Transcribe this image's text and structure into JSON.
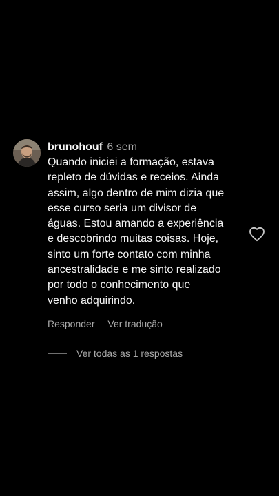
{
  "comment": {
    "username": "brunohouf",
    "timestamp": "6 sem",
    "text_lines": [
      "Quando iniciei a formação, estava",
      "repleto de dúvidas e receios. Ainda",
      "assim, algo dentro de mim dizia que",
      "esse curso seria um divisor de",
      "águas. Estou amando a experiência",
      "e descobrindo muitas coisas. Hoje,",
      "sinto um forte contato com minha",
      "ancestralidade e me sinto realizado",
      "por todo o conhecimento que",
      "venho adquirindo."
    ],
    "avatar_icon": "user-avatar",
    "like_icon": "heart-outline-icon"
  },
  "actions": {
    "reply_label": "Responder",
    "translate_label": "Ver tradução"
  },
  "replies": {
    "label": "Ver todas as 1 respostas"
  },
  "colors": {
    "background": "#000000",
    "primary_text": "#f5f5f5",
    "secondary_text": "#a8a8a8"
  }
}
